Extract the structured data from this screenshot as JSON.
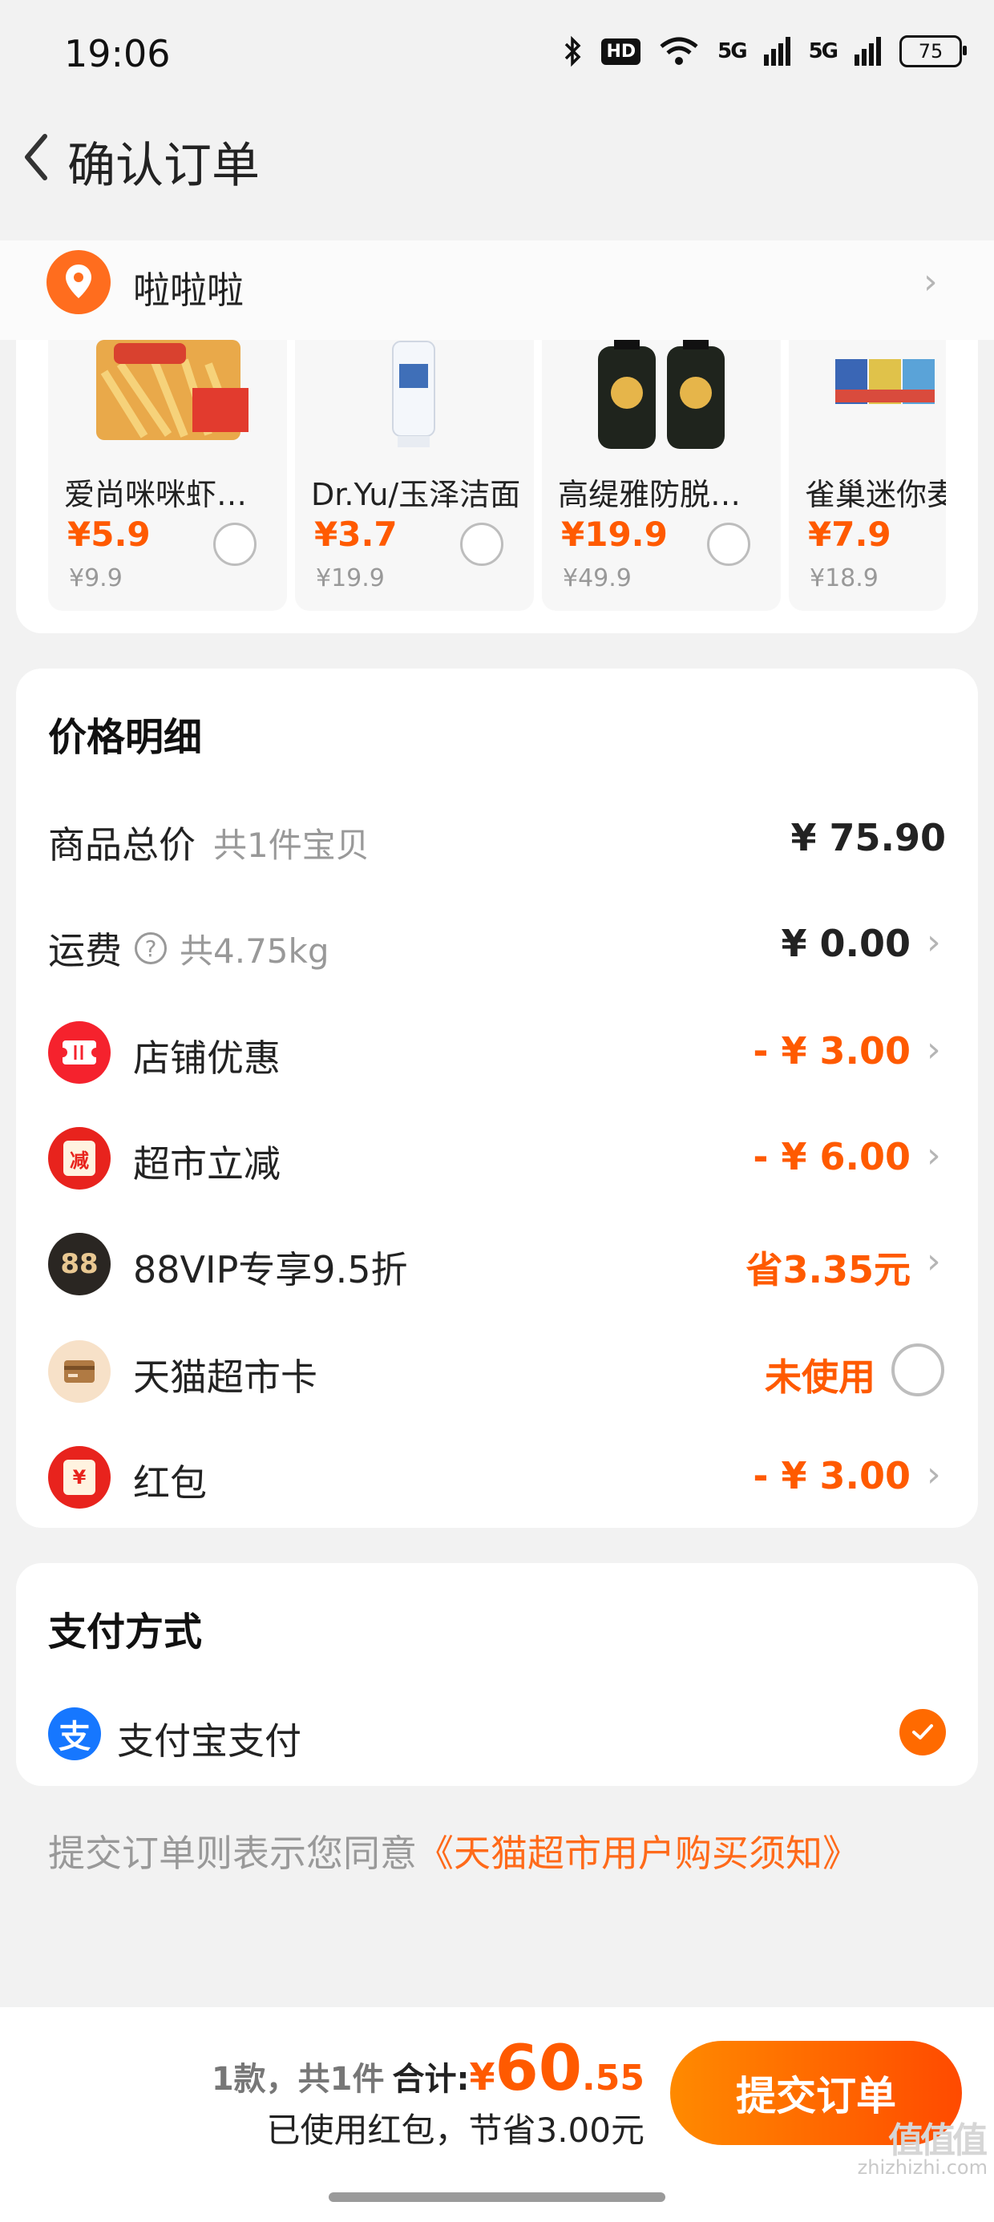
{
  "status_bar": {
    "time": "19:06",
    "hd": "HD",
    "net1": "5G",
    "net2": "5G",
    "battery": "75"
  },
  "header": {
    "title": "确认订单"
  },
  "address": {
    "name": "啦啦啦"
  },
  "products": [
    {
      "name": "爱尚咪咪虾味条",
      "price": "¥5.9",
      "original_price": "¥9.9"
    },
    {
      "name": "Dr.Yu/玉泽洁面",
      "price": "¥3.7",
      "original_price": "¥19.9"
    },
    {
      "name": "高缇雅防脱发洗发水",
      "price": "¥19.9",
      "original_price": "¥49.9"
    },
    {
      "name": "雀巢迷你麦片",
      "price": "¥7.9",
      "original_price": "¥18.9"
    }
  ],
  "price_detail": {
    "title": "价格明细",
    "goods_total": {
      "label": "商品总价",
      "sub": "共1件宝贝",
      "value": "¥ 75.90"
    },
    "shipping": {
      "label": "运费",
      "help": "?",
      "sub": "共4.75kg",
      "value": "¥ 0.00"
    },
    "shop_discount": {
      "label": "店铺优惠",
      "value": "- ¥ 3.00"
    },
    "market_discount": {
      "label": "超市立减",
      "icon_text": "减",
      "value": "- ¥ 6.00"
    },
    "vip": {
      "label": "88VIP专享9.5折",
      "icon_text": "88",
      "value": "省3.35元"
    },
    "card": {
      "label": "天猫超市卡",
      "value": "未使用"
    },
    "red_packet": {
      "label": "红包",
      "icon_text": "¥",
      "value": "- ¥ 3.00"
    }
  },
  "payment": {
    "title": "支付方式",
    "method": "支付宝支付",
    "icon_text": "支"
  },
  "agreement": {
    "text": "提交订单则表示您同意",
    "link": "《天猫超市用户购买须知》"
  },
  "bottom": {
    "count": "1款，共1件",
    "total_label": "合计:",
    "yen": "¥",
    "total_int": "60",
    "total_dec": ".55",
    "saved_note": "已使用红包，节省3.00元",
    "submit": "提交订单"
  },
  "watermark": {
    "logo": "值值值",
    "site": "zhizhizhi.com"
  },
  "colors": {
    "accent": "#ff5a00",
    "alipay": "#1677ff",
    "background": "#f2f2f2"
  }
}
